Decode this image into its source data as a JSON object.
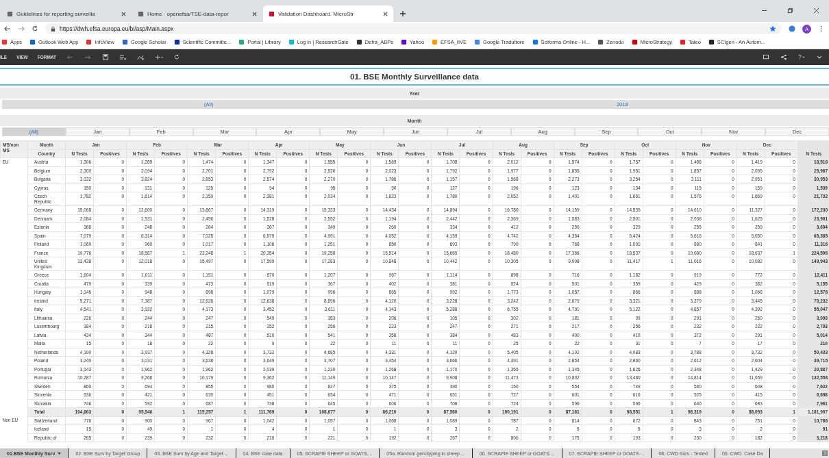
{
  "browser": {
    "tabs": [
      {
        "title": "Guidelines for reporting surveilla",
        "selected": false
      },
      {
        "title": "Home · openefsa/TSE-data-repor",
        "selected": false
      },
      {
        "title": "Validation Dashboard. MicroStr",
        "selected": true
      }
    ],
    "address": "https://dwh.efsa.europa.eu/bi/asp/Main.aspx",
    "bookmarks": [
      "Apps",
      "Outlook Web App",
      "InfoView",
      "Google Scholar",
      "Scientific Committe...",
      "Portal | Library",
      "Log in | ResearchGate",
      "Defra_ABPs",
      "Yahoo",
      "EFSA_IIVE",
      "Google Traduttore",
      "Sciforma Online - H...",
      "Zenodo",
      "MicroStrategy",
      "Taleo",
      "SCIgen - An Autom..."
    ],
    "profile": "A"
  },
  "toolbar": {
    "menus": [
      "ILE",
      "VIEW",
      "FORMAT"
    ]
  },
  "title": "01. BSE Monthly Surveillance data",
  "year_filter": {
    "label": "Year",
    "options": [
      {
        "label": "(All)"
      },
      {
        "label": "2018"
      }
    ]
  },
  "month_filter": {
    "label": "Month",
    "options": [
      {
        "label": "(All)",
        "selected": true
      },
      {
        "label": "Jan",
        "selected": false
      },
      {
        "label": "Feb",
        "selected": false
      },
      {
        "label": "Mar",
        "selected": false
      },
      {
        "label": "Apr",
        "selected": false
      },
      {
        "label": "May",
        "selected": false
      },
      {
        "label": "Jun",
        "selected": false
      },
      {
        "label": "Jul",
        "selected": false
      },
      {
        "label": "Aug",
        "selected": false
      },
      {
        "label": "Sep",
        "selected": false
      },
      {
        "label": "Oct",
        "selected": false
      },
      {
        "label": "Nov",
        "selected": false
      },
      {
        "label": "Dec",
        "selected": false
      }
    ]
  },
  "table": {
    "group_header": "MS/non MS",
    "month_header": "Month",
    "country_header": "Country",
    "months": [
      {
        "label": "Jan",
        "measures": [
          "N Tests",
          "Positives"
        ]
      },
      {
        "label": "Feb",
        "measures": [
          "N Tests",
          "Positives"
        ]
      },
      {
        "label": "Mar",
        "measures": [
          "N Tests",
          "Positives"
        ]
      },
      {
        "label": "Apr",
        "measures": [
          "N Tests",
          "Positives"
        ]
      },
      {
        "label": "May",
        "measures": [
          "N Tests",
          "Positives"
        ]
      },
      {
        "label": "Jun",
        "measures": [
          "N Tests",
          "Positives"
        ]
      },
      {
        "label": "Jul",
        "measures": [
          "N Tests",
          "Positives"
        ]
      },
      {
        "label": "Aug",
        "measures": [
          "N Tests",
          "Positives"
        ]
      },
      {
        "label": "Sep",
        "measures": [
          "N Tests",
          "Positives"
        ]
      },
      {
        "label": "Oct",
        "measures": [
          "N Tests",
          "Positives"
        ]
      },
      {
        "label": "Nov",
        "measures": [
          "N Tests",
          "Positives"
        ]
      },
      {
        "label": "Dec",
        "measures": [
          "N Tests",
          "Positives"
        ]
      }
    ],
    "total_measure": "N Tests",
    "groups": [
      {
        "label": "EU",
        "rows": [
          {
            "kind": "country",
            "country": "Austria",
            "tests": [
              "1,306",
              "1,289",
              "1,474",
              "1,347",
              "1,555",
              "1,589",
              "1,708",
              "2,012",
              "1,574",
              "1,757",
              "1,486",
              "1,419"
            ],
            "positives": [
              "0",
              "0",
              "0",
              "0",
              "0",
              "0",
              "0",
              "0",
              "0",
              "0",
              "0",
              "0"
            ],
            "total": "18,516"
          },
          {
            "kind": "country",
            "country": "Belgium",
            "tests": [
              "2,300",
              "2,094",
              "2,701",
              "2,792",
              "2,530",
              "2,023",
              "1,792",
              "1,977",
              "1,855",
              "1,951",
              "1,857",
              "2,095"
            ],
            "positives": [
              "0",
              "0",
              "0",
              "0",
              "0",
              "0",
              "0",
              "0",
              "0",
              "0",
              "0",
              "0"
            ],
            "total": "25,967"
          },
          {
            "kind": "country",
            "country": "Bulgaria",
            "tests": [
              "3,332",
              "3,824",
              "2,853",
              "2,574",
              "2,270",
              "1,786",
              "1,157",
              "1,568",
              "2,273",
              "3,254",
              "3,111",
              "2,951"
            ],
            "positives": [
              "0",
              "0",
              "0",
              "0",
              "0",
              "0",
              "0",
              "0",
              "0",
              "0",
              "0",
              "0"
            ],
            "total": "30,953"
          },
          {
            "kind": "country",
            "country": "Cyprus",
            "tests": [
              "150",
              "131",
              "125",
              "94",
              "95",
              "90",
              "127",
              "196",
              "123",
              "134",
              "115",
              "159"
            ],
            "positives": [
              "0",
              "0",
              "0",
              "0",
              "0",
              "0",
              "0",
              "0",
              "0",
              "0",
              "0",
              "0"
            ],
            "total": "1,539"
          },
          {
            "kind": "country",
            "country": "Czech Republic",
            "tests": [
              "1,782",
              "1,614",
              "2,159",
              "2,381",
              "2,034",
              "1,623",
              "1,780",
              "2,052",
              "1,401",
              "1,661",
              "1,576",
              "1,669"
            ],
            "positives": [
              "0",
              "0",
              "0",
              "0",
              "0",
              "0",
              "0",
              "0",
              "0",
              "0",
              "0",
              "0"
            ],
            "total": "21,732"
          },
          {
            "kind": "country",
            "country": "Germany",
            "tests": [
              "15,068",
              "12,600",
              "13,867",
              "14,319",
              "15,333",
              "14,434",
              "14,894",
              "16,780",
              "14,159",
              "14,839",
              "14,610",
              "11,327"
            ],
            "positives": [
              "0",
              "0",
              "0",
              "0",
              "0",
              "0",
              "0",
              "0",
              "0",
              "0",
              "0",
              "0"
            ],
            "total": "172,230"
          },
          {
            "kind": "country",
            "country": "Denmark",
            "tests": [
              "2,084",
              "1,531",
              "2,456",
              "1,528",
              "2,552",
              "1,194",
              "2,442",
              "2,369",
              "1,583",
              "2,501",
              "2,036",
              "1,625"
            ],
            "positives": [
              "0",
              "0",
              "0",
              "0",
              "0",
              "0",
              "0",
              "0",
              "0",
              "0",
              "0",
              "0"
            ],
            "total": "23,901"
          },
          {
            "kind": "country",
            "country": "Estonia",
            "tests": [
              "368",
              "248",
              "264",
              "267",
              "349",
              "260",
              "334",
              "412",
              "259",
              "329",
              "255",
              "259"
            ],
            "positives": [
              "0",
              "0",
              "0",
              "0",
              "0",
              "0",
              "0",
              "0",
              "0",
              "0",
              "0",
              "0"
            ],
            "total": "3,604"
          },
          {
            "kind": "country",
            "country": "Spain",
            "tests": [
              "7,079",
              "6,314",
              "7,025",
              "6,579",
              "4,991",
              "4,052",
              "4,159",
              "4,742",
              "4,354",
              "5,424",
              "5,616",
              "5,050"
            ],
            "positives": [
              "0",
              "0",
              "0",
              "0",
              "0",
              "0",
              "0",
              "0",
              "0",
              "0",
              "0",
              "0"
            ],
            "total": "65,385"
          },
          {
            "kind": "country",
            "country": "Finland",
            "tests": [
              "1,069",
              "960",
              "1,017",
              "1,106",
              "1,251",
              "850",
              "693",
              "790",
              "768",
              "1,091",
              "880",
              "841"
            ],
            "positives": [
              "0",
              "0",
              "0",
              "0",
              "0",
              "0",
              "0",
              "0",
              "0",
              "0",
              "0",
              "0"
            ],
            "total": "11,316"
          },
          {
            "kind": "country",
            "country": "France",
            "tests": [
              "19,776",
              "18,587",
              "23,248",
              "20,354",
              "19,258",
              "15,514",
              "15,669",
              "18,480",
              "17,366",
              "18,537",
              "19,080",
              "18,637"
            ],
            "positives": [
              "0",
              "1",
              "1",
              "0",
              "0",
              "0",
              "0",
              "0",
              "0",
              "0",
              "0",
              "1"
            ],
            "total": "224,506"
          },
          {
            "kind": "country",
            "country": "United Kingdom",
            "tests": [
              "13,438",
              "12,018",
              "15,497",
              "17,599",
              "17,283",
              "10,848",
              "10,442",
              "10,305",
              "9,998",
              "11,417",
              "11,016",
              "10,082"
            ],
            "positives": [
              "0",
              "0",
              "0",
              "0",
              "0",
              "0",
              "0",
              "0",
              "0",
              "1",
              "0",
              "0"
            ],
            "total": "149,943"
          },
          {
            "kind": "country",
            "country": "Greece",
            "tests": [
              "1,604",
              "1,011",
              "1,151",
              "870",
              "1,207",
              "967",
              "1,114",
              "898",
              "716",
              "1,182",
              "919",
              "772"
            ],
            "positives": [
              "0",
              "0",
              "0",
              "0",
              "0",
              "0",
              "0",
              "0",
              "0",
              "0",
              "0",
              "0"
            ],
            "total": "12,411"
          },
          {
            "kind": "country",
            "country": "Croatia",
            "tests": [
              "479",
              "339",
              "473",
              "519",
              "367",
              "402",
              "381",
              "524",
              "501",
              "359",
              "429",
              "382"
            ],
            "positives": [
              "0",
              "0",
              "0",
              "0",
              "0",
              "0",
              "0",
              "0",
              "0",
              "0",
              "0",
              "0"
            ],
            "total": "5,155"
          },
          {
            "kind": "country",
            "country": "Hungary",
            "tests": [
              "1,146",
              "948",
              "898",
              "1,079",
              "996",
              "865",
              "992",
              "1,773",
              "1,057",
              "866",
              "888",
              "1,068"
            ],
            "positives": [
              "0",
              "0",
              "0",
              "0",
              "0",
              "0",
              "0",
              "0",
              "0",
              "0",
              "0",
              "0"
            ],
            "total": "12,576"
          },
          {
            "kind": "country",
            "country": "Ireland",
            "tests": [
              "5,271",
              "7,387",
              "12,626",
              "12,638",
              "8,896",
              "4,120",
              "3,228",
              "3,242",
              "2,679",
              "3,321",
              "3,379",
              "3,445"
            ],
            "positives": [
              "0",
              "0",
              "0",
              "0",
              "0",
              "0",
              "0",
              "0",
              "0",
              "0",
              "0",
              "0"
            ],
            "total": "70,232"
          },
          {
            "kind": "country",
            "country": "Italy",
            "tests": [
              "4,541",
              "3,922",
              "4,173",
              "3,452",
              "3,611",
              "4,143",
              "5,288",
              "6,755",
              "4,791",
              "5,122",
              "4,857",
              "4,392"
            ],
            "positives": [
              "0",
              "0",
              "0",
              "0",
              "0",
              "0",
              "0",
              "0",
              "0",
              "0",
              "0",
              "0"
            ],
            "total": "55,047"
          },
          {
            "kind": "country",
            "country": "Lithuania",
            "tests": [
              "226",
              "244",
              "247",
              "549",
              "383",
              "206",
              "105",
              "302",
              "181",
              "99",
              "291",
              "260"
            ],
            "positives": [
              "0",
              "0",
              "0",
              "0",
              "0",
              "0",
              "0",
              "0",
              "0",
              "0",
              "0",
              "0"
            ],
            "total": "3,093"
          },
          {
            "kind": "country",
            "country": "Luxembourg",
            "tests": [
              "184",
              "218",
              "215",
              "252",
              "256",
              "223",
              "247",
              "271",
              "217",
              "256",
              "232",
              "222"
            ],
            "positives": [
              "0",
              "0",
              "0",
              "0",
              "0",
              "0",
              "0",
              "0",
              "0",
              "0",
              "0",
              "0"
            ],
            "total": "2,793"
          },
          {
            "kind": "country",
            "country": "Latvia",
            "tests": [
              "434",
              "344",
              "487",
              "510",
              "541",
              "358",
              "384",
              "483",
              "400",
              "410",
              "372",
              "291"
            ],
            "positives": [
              "0",
              "0",
              "0",
              "0",
              "0",
              "0",
              "0",
              "0",
              "0",
              "0",
              "0",
              "0"
            ],
            "total": "5,014"
          },
          {
            "kind": "country",
            "country": "Malta",
            "tests": [
              "15",
              "18",
              "22",
              "9",
              "22",
              "11",
              "11",
              "25",
              "22",
              "31",
              "7",
              "17"
            ],
            "positives": [
              "0",
              "0",
              "0",
              "0",
              "0",
              "0",
              "0",
              "0",
              "0",
              "0",
              "0",
              "0"
            ],
            "total": "210"
          },
          {
            "kind": "country",
            "country": "Netherlands",
            "tests": [
              "4,190",
              "3,937",
              "4,328",
              "3,732",
              "4,685",
              "4,331",
              "4,120",
              "5,405",
              "4,102",
              "4,083",
              "3,788",
              "3,732"
            ],
            "positives": [
              "0",
              "0",
              "0",
              "0",
              "0",
              "0",
              "0",
              "0",
              "0",
              "0",
              "0",
              "0"
            ],
            "total": "50,433"
          },
          {
            "kind": "country",
            "country": "Poland",
            "tests": [
              "3,249",
              "3,031",
              "3,638",
              "3,649",
              "3,707",
              "3,454",
              "3,666",
              "4,391",
              "2,854",
              "2,860",
              "2,612",
              "2,604"
            ],
            "positives": [
              "0",
              "0",
              "0",
              "0",
              "0",
              "0",
              "0",
              "0",
              "0",
              "0",
              "0",
              "0"
            ],
            "total": "39,715"
          },
          {
            "kind": "country",
            "country": "Portugal",
            "tests": [
              "3,143",
              "1,962",
              "1,962",
              "2,039",
              "1,230",
              "1,268",
              "1,170",
              "1,365",
              "1,345",
              "1,626",
              "2,348",
              "1,429"
            ],
            "positives": [
              "0",
              "0",
              "0",
              "0",
              "0",
              "0",
              "0",
              "0",
              "0",
              "0",
              "0",
              "0"
            ],
            "total": "20,887"
          },
          {
            "kind": "country",
            "country": "Romania",
            "tests": [
              "10,287",
              "9,268",
              "10,179",
              "9,362",
              "11,149",
              "10,147",
              "9,908",
              "11,473",
              "10,832",
              "13,480",
              "14,814",
              "11,659"
            ],
            "positives": [
              "0",
              "0",
              "0",
              "0",
              "0",
              "0",
              "0",
              "0",
              "0",
              "0",
              "0",
              "0"
            ],
            "total": "132,558"
          },
          {
            "kind": "country",
            "country": "Sweden",
            "tests": [
              "860",
              "694",
              "855",
              "980",
              "827",
              "375",
              "390",
              "150",
              "554",
              "749",
              "580",
              "608"
            ],
            "positives": [
              "0",
              "0",
              "0",
              "0",
              "0",
              "0",
              "0",
              "0",
              "0",
              "0",
              "0",
              "0"
            ],
            "total": "7,622"
          },
          {
            "kind": "country",
            "country": "Slovenia",
            "tests": [
              "536",
              "421",
              "630",
              "451",
              "654",
              "471",
              "651",
              "727",
              "601",
              "616",
              "525",
              "415"
            ],
            "positives": [
              "0",
              "0",
              "0",
              "0",
              "0",
              "0",
              "0",
              "0",
              "0",
              "0",
              "0",
              "0"
            ],
            "total": "6,698"
          },
          {
            "kind": "country",
            "country": "Slovakia",
            "tests": [
              "746",
              "592",
              "687",
              "738",
              "645",
              "606",
              "708",
              "724",
              "596",
              "596",
              "640",
              "683"
            ],
            "positives": [
              "0",
              "0",
              "0",
              "0",
              "0",
              "0",
              "0",
              "0",
              "0",
              "0",
              "0",
              "0"
            ],
            "total": "7,961"
          },
          {
            "kind": "total",
            "country": "Total",
            "tests": [
              "104,663",
              "95,546",
              "115,257",
              "111,769",
              "108,677",
              "86,210",
              "87,560",
              "100,191",
              "87,161",
              "98,551",
              "98,319",
              "88,093"
            ],
            "positives": [
              "0",
              "1",
              "1",
              "0",
              "0",
              "0",
              "0",
              "0",
              "0",
              "1",
              "0",
              "1"
            ],
            "total": "1,181,997"
          }
        ]
      },
      {
        "label": "Non EU",
        "rows": [
          {
            "kind": "country",
            "country": "Switzerland",
            "tests": [
              "776",
              "900",
              "967",
              "1,042",
              "1,057",
              "1,068",
              "1,089",
              "787",
              "814",
              "672",
              "843",
              "751"
            ],
            "positives": [
              "0",
              "0",
              "0",
              "0",
              "0",
              "0",
              "0",
              "0",
              "0",
              "0",
              "0",
              "0"
            ],
            "total": "10,766"
          },
          {
            "kind": "country",
            "country": "Iceland",
            "tests": [
              "15",
              "49",
              "1",
              "4",
              "1",
              "1",
              "3",
              "2",
              "5",
              "5",
              "3",
              "2"
            ],
            "positives": [
              "0",
              "0",
              "0",
              "0",
              "0",
              "0",
              "0",
              "0",
              "0",
              "0",
              "0",
              "0"
            ],
            "total": "91"
          },
          {
            "kind": "country",
            "country": "Republic of",
            "tests": [
              "265",
              "239",
              "232",
              "216",
              "221",
              "192",
              "267",
              "806",
              "175",
              "193",
              "230",
              "182"
            ],
            "positives": [
              "0",
              "0",
              "0",
              "0",
              "0",
              "0",
              "0",
              "0",
              "0",
              "0",
              "0",
              "0"
            ],
            "total": "3,218"
          }
        ]
      }
    ]
  },
  "sheet_tabs": [
    {
      "label": "01.BSE Monthly Surv",
      "selected": true
    },
    {
      "label": "02. BSE Surv by Target Group",
      "selected": false
    },
    {
      "label": "03. BSE Surv by Age and Target....",
      "selected": false
    },
    {
      "label": "04. BSE case data",
      "selected": false
    },
    {
      "label": "05. SCRAPIE SHEEP or GOATS....",
      "selected": false
    },
    {
      "label": "05a. Random genotyping in sheep....",
      "selected": false
    },
    {
      "label": "06. SCRAPIE SHEEP or GOATS....",
      "selected": false
    },
    {
      "label": "07. SCRAPIE SHEEP or GOATS....",
      "selected": false
    },
    {
      "label": "08. CWD Surv - Tested",
      "selected": false
    },
    {
      "label": "09. CWD. Case Da",
      "selected": false
    }
  ]
}
